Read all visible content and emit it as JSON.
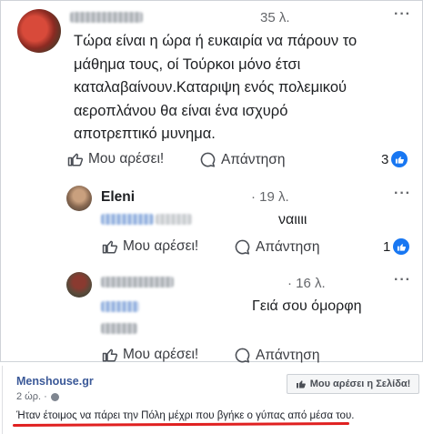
{
  "comment1": {
    "time": "35 λ.",
    "lines": [
      "Τώρα είναι η ώρα ή ευκαιρία να πάρουν το",
      "μάθημα τους, οί Τούρκοι μόνο έτσι",
      "καταλαβαίνουν.Καταριψη ενός πολεμικού",
      "αεροπλάνου θα είναι ένα ισχυρό",
      "αποτρεπτικό μυνημα."
    ],
    "like_label": "Μου αρέσει!",
    "reply_label": "Απάντηση",
    "reaction_count": "3"
  },
  "reply1": {
    "name": "Eleni",
    "time": "· 19 λ.",
    "text": "ναιιιι",
    "like_label": "Μου αρέσει!",
    "reply_label": "Απάντηση",
    "reaction_count": "1"
  },
  "reply2": {
    "time": "· 16 λ.",
    "text": "Γειά σου όμορφη",
    "like_label": "Μου αρέσει!",
    "reply_label": "Απάντηση"
  },
  "post": {
    "site": "Menshouse.gr",
    "time": "2 ώρ. ·",
    "like_page_label": "Μου αρέσει η Σελίδα!",
    "caption": "Ήταν έτοιμος να πάρει την Πόλη μέχρι που βγήκε ο γύπας από μέσα του."
  },
  "colors": {
    "accent": "#1877f2",
    "link": "#3b5998",
    "underline": "#e02020"
  }
}
